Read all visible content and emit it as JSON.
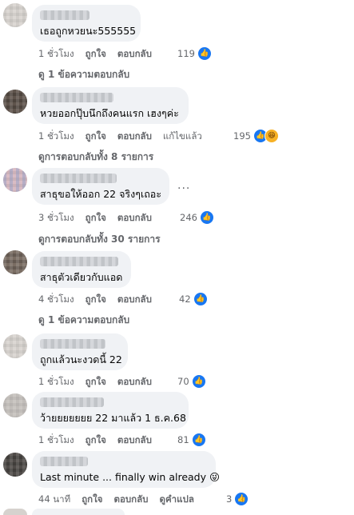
{
  "comments": [
    {
      "text": "เธอถูกหวยนะ555555",
      "time": "1 ชั่วโมง",
      "like": "ถูกใจ",
      "reply": "ตอบกลับ",
      "reactions": "119",
      "replies": "ดู 1 ข้อความตอบกลับ"
    },
    {
      "text": "หวยออกปุ๊บนึกถึงคนแรก เฮงๆค่ะ",
      "time": "1 ชั่วโมง",
      "like": "ถูกใจ",
      "reply": "ตอบกลับ",
      "edited": "แก้ไขแล้ว",
      "reactions": "195",
      "replies": "ดูการตอบกลับทั้ง 8 รายการ"
    },
    {
      "text": "สาธุขอให้ออก 22 จริงๆเถอะ",
      "time": "3 ชั่วโมง",
      "like": "ถูกใจ",
      "reply": "ตอบกลับ",
      "reactions": "246",
      "replies": "ดูการตอบกลับทั้ง 30 รายการ",
      "more": "..."
    },
    {
      "text": "สาธุตัวเดียวกับแอด",
      "time": "4 ชั่วโมง",
      "like": "ถูกใจ",
      "reply": "ตอบกลับ",
      "reactions": "42",
      "replies": "ดู 1 ข้อความตอบกลับ"
    },
    {
      "text": "ถูกแล้วนะงวดนี้ 22",
      "time": "1 ชั่วโมง",
      "like": "ถูกใจ",
      "reply": "ตอบกลับ",
      "reactions": "70"
    },
    {
      "text": "ว้ายยยยยยย 22 มาแล้ว 1 ธ.ค.68",
      "time": "1 ชั่วโมง",
      "like": "ถูกใจ",
      "reply": "ตอบกลับ",
      "reactions": "81"
    },
    {
      "text": "Last minute ... finally win already 😜",
      "time": "44 นาที",
      "like": "ถูกใจ",
      "reply": "ตอบกลับ",
      "translate": "ดูคำแปล",
      "reactions": "3"
    }
  ],
  "icons": {
    "like": "like-icon",
    "haha": "haha-icon",
    "like_color": "#1877f2"
  }
}
